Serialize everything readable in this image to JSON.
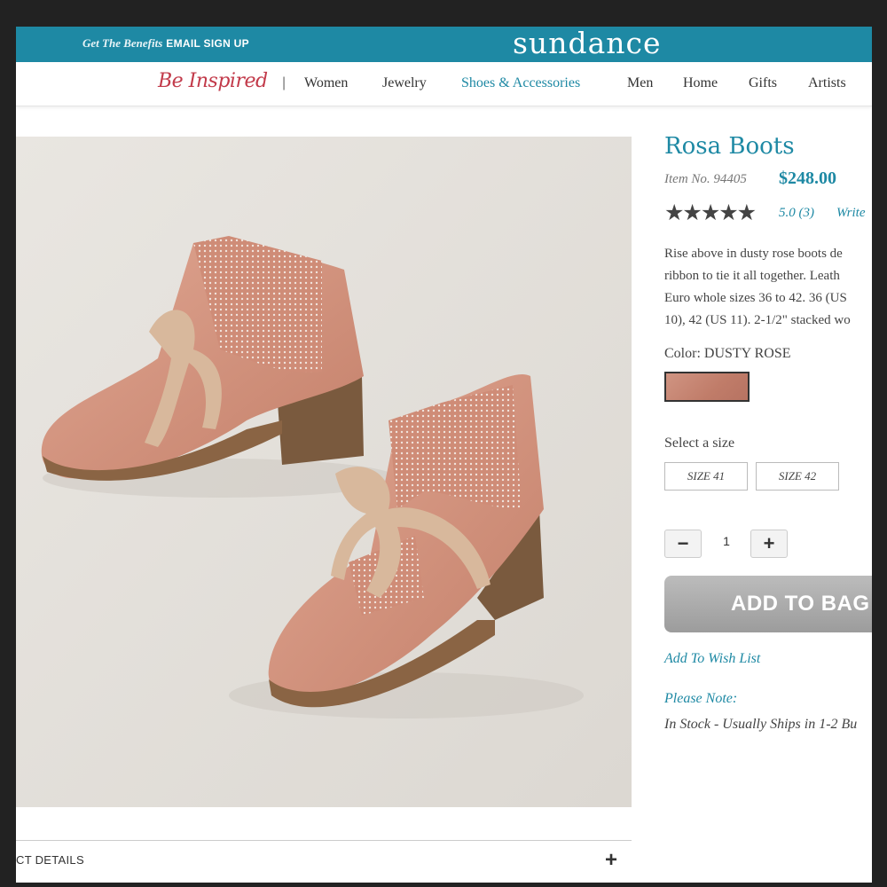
{
  "topbar": {
    "promo_text": "Get The Benefits",
    "promo_link": "EMAIL SIGN UP",
    "logo": "sundance"
  },
  "nav": {
    "tagline": "Be Inspired",
    "separator": "|",
    "items": [
      {
        "label": "Women"
      },
      {
        "label": "Jewelry"
      },
      {
        "label": "Shoes & Accessories"
      },
      {
        "label": "Men"
      },
      {
        "label": "Home"
      },
      {
        "label": "Gifts"
      },
      {
        "label": "Artists"
      }
    ],
    "active_item": "Shoes & Accessories"
  },
  "product": {
    "title": "Rosa Boots",
    "item_no": "Item No. 94405",
    "price": "$248.00",
    "stars": "★★★★★",
    "rating": "5.0 (3)",
    "write_review": "Write",
    "description_lines": [
      "Rise above in dusty rose boots de",
      "ribbon to tie it all together. Leath",
      "Euro whole sizes 36 to 42. 36 (US",
      "10), 42 (US 11). 2-1/2\" stacked wo"
    ],
    "color_label": "Color: DUSTY ROSE",
    "swatch_color": "#c98876",
    "size_label": "Select a size",
    "sizes": [
      "SIZE 41",
      "SIZE 42"
    ],
    "quantity": "1",
    "minus": "−",
    "plus": "+",
    "add_to_bag": "ADD TO BAG",
    "wish_list": "Add To Wish List",
    "please_note": "Please Note:",
    "stock_status": "In Stock - Usually Ships in 1-2 Bu"
  },
  "details": {
    "label": "CT DETAILS",
    "toggle": "+"
  },
  "colors": {
    "brand_teal": "#1e89a4",
    "tagline_red": "#c23a4a",
    "button_grey": "#a6a6a6"
  }
}
